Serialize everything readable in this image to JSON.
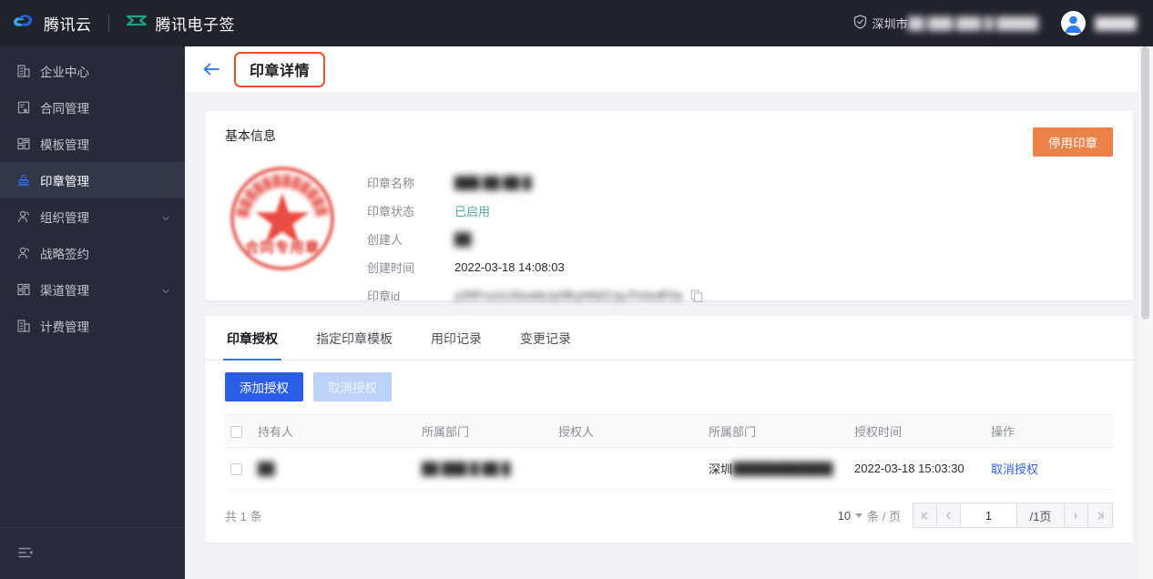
{
  "topbar": {
    "brand_primary": "腾讯云",
    "brand_secondary": "腾讯电子签",
    "corp_name_prefix": "深圳市",
    "corp_name_redacted": "██ ███ ███ █ █████",
    "user_name_redacted": "█████",
    "icons": {
      "cloud": "cloud-icon",
      "esign": "esign-icon",
      "shield": "shield-check-icon",
      "avatar": "user-avatar-icon"
    }
  },
  "sidebar": {
    "items": [
      {
        "label": "企业中心",
        "icon": "building-icon",
        "active": false,
        "expandable": false
      },
      {
        "label": "合同管理",
        "icon": "contract-icon",
        "active": false,
        "expandable": false
      },
      {
        "label": "模板管理",
        "icon": "template-grid-icon",
        "active": false,
        "expandable": false
      },
      {
        "label": "印章管理",
        "icon": "stamp-icon",
        "active": true,
        "expandable": false
      },
      {
        "label": "组织管理",
        "icon": "users-icon",
        "active": false,
        "expandable": true
      },
      {
        "label": "战略签约",
        "icon": "users-icon",
        "active": false,
        "expandable": true,
        "show_chevron": false
      },
      {
        "label": "渠道管理",
        "icon": "template-grid-icon",
        "active": false,
        "expandable": true
      },
      {
        "label": "计费管理",
        "icon": "building-icon",
        "active": false,
        "expandable": false
      }
    ],
    "collapse_icon": "sidebar-collapse-icon"
  },
  "page": {
    "back_icon": "back-arrow-icon",
    "title": "印章详情"
  },
  "basic": {
    "section_title": "基本信息",
    "disable_button": "停用印章",
    "seal": {
      "bottom_text": "合同专用章",
      "arc_text_redacted": "████████████████",
      "color": "#e03b32"
    },
    "fields": [
      {
        "label": "印章名称",
        "value": "███  ██ ██ █",
        "redacted": true,
        "type": "text"
      },
      {
        "label": "印章状态",
        "value": "已启用",
        "redacted": false,
        "type": "status"
      },
      {
        "label": "创建人",
        "value": "██",
        "redacted": true,
        "type": "text"
      },
      {
        "label": "创建时间",
        "value": "2022-03-18 14:08:03",
        "redacted": false,
        "type": "text"
      },
      {
        "label": "印章id",
        "value": "y2RFruUL00oxkbJy0fKyhfd2Cay.PmtvdF0a",
        "redacted": true,
        "type": "id"
      }
    ],
    "copy_icon": "copy-icon"
  },
  "tabs_card": {
    "tabs": [
      {
        "label": "印章授权",
        "active": true
      },
      {
        "label": "指定印章模板",
        "active": false
      },
      {
        "label": "用印记录",
        "active": false
      },
      {
        "label": "变更记录",
        "active": false
      }
    ],
    "toolbar": {
      "add_label": "添加授权",
      "cancel_label": "取消授权"
    },
    "table": {
      "columns": [
        "持有人",
        "所属部门",
        "授权人",
        "所属部门",
        "授权时间",
        "操作"
      ],
      "rows": [
        {
          "holder": "██",
          "holder_dept": "██ ███ █ ██  █",
          "grantor": "",
          "grantor_dept_prefix": "深圳",
          "grantor_dept_redacted": "████████████",
          "granted_at": "2022-03-18 15:03:30",
          "action": "取消授权"
        }
      ]
    },
    "pager": {
      "total_text": "共 1 条",
      "per_page": "10",
      "per_page_unit": "条 / 页",
      "current_page": "1",
      "total_pages": "/1页",
      "first_icon": "page-first-icon",
      "prev_icon": "page-prev-icon",
      "next_icon": "page-next-icon",
      "last_icon": "page-last-icon"
    }
  },
  "colors": {
    "brand_blue": "#2b5ee8",
    "accent_orange": "#ec8248",
    "highlight_red": "#ed4f27",
    "status_teal": "#4fa9a3",
    "sidebar_bg": "#272b39",
    "topbar_bg": "#20222c"
  }
}
